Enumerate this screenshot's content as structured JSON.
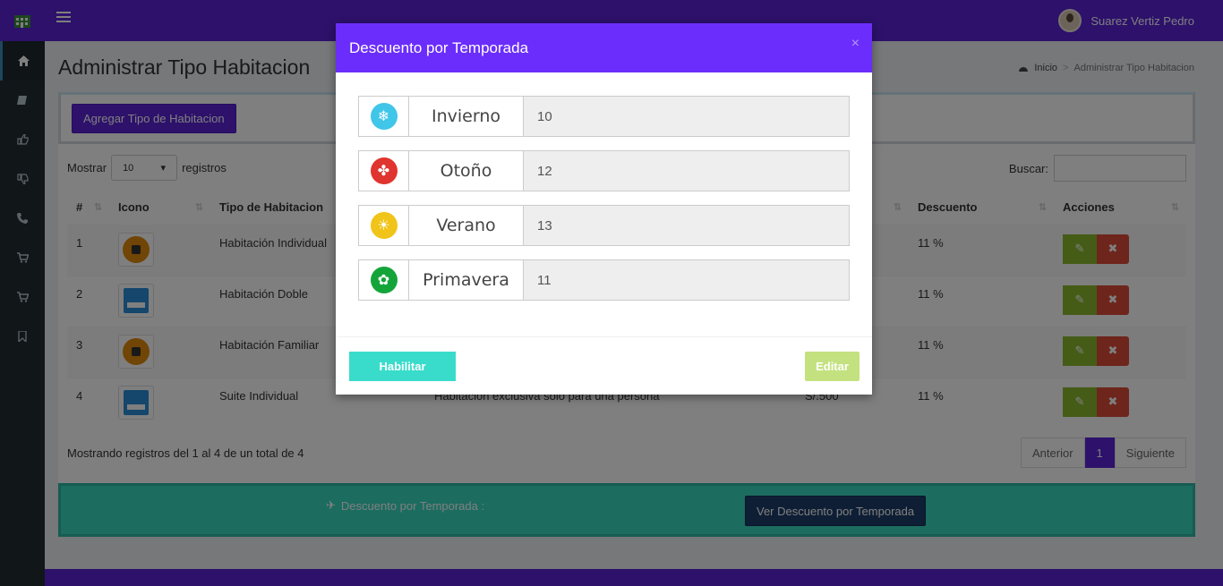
{
  "header": {
    "user_name": "Suarez Vertiz Pedro"
  },
  "page": {
    "title": "Administrar Tipo Habitacion",
    "breadcrumb": {
      "home": "Inicio",
      "sep": ">",
      "current": "Administrar Tipo Habitacion"
    },
    "add_button": "Agregar Tipo de Habitacion"
  },
  "table": {
    "show_label": "Mostrar",
    "show_value": "10",
    "records_label": "registros",
    "search_label": "Buscar:",
    "columns": [
      "#",
      "Icono",
      "Tipo de Habitacion",
      "",
      "",
      "Descuento",
      "Acciones"
    ],
    "rows": [
      {
        "num": "1",
        "icon": "lock-icon",
        "tipo": "Habitación Individual",
        "descripcion": "",
        "precio": "",
        "descuento": "11 %"
      },
      {
        "num": "2",
        "icon": "bed-icon",
        "tipo": "Habitación Doble",
        "descripcion": "",
        "precio": "",
        "descuento": "11 %"
      },
      {
        "num": "3",
        "icon": "lock-icon",
        "tipo": "Habitación Familiar",
        "descripcion": "",
        "precio": "",
        "descuento": "11 %"
      },
      {
        "num": "4",
        "icon": "bed-icon",
        "tipo": "Suite Individual",
        "descripcion": "Habitacion exclusiva solo para una persona",
        "precio": "S/.500",
        "descuento": "11 %"
      }
    ],
    "info": "Mostrando registros del 1 al 4 de un total de 4",
    "pager": {
      "prev": "Anterior",
      "current": "1",
      "next": "Siguiente"
    }
  },
  "promo": {
    "label": "Descuento por Temporada :",
    "button": "Ver Descuento por Temporada"
  },
  "modal": {
    "title": "Descuento por Temporada",
    "close": "×",
    "seasons": [
      {
        "name": "Invierno",
        "value": "10",
        "icon": "snowflake-icon",
        "color": "#3fc6e8"
      },
      {
        "name": "Otoño",
        "value": "12",
        "icon": "maple-leaf-icon",
        "color": "#e0342e"
      },
      {
        "name": "Verano",
        "value": "13",
        "icon": "sun-icon",
        "color": "#f0c419"
      },
      {
        "name": "Primavera",
        "value": "11",
        "icon": "flower-icon",
        "color": "#14a53a"
      }
    ],
    "enable_button": "Habilitar",
    "edit_button": "Editar"
  },
  "colors": {
    "brand": "#5a22d6",
    "modal_header": "#6b2dfb",
    "sidebar": "#222d32",
    "promo": "#39d8c1",
    "edit": "#8ab82e",
    "delete": "#dd4b39"
  }
}
